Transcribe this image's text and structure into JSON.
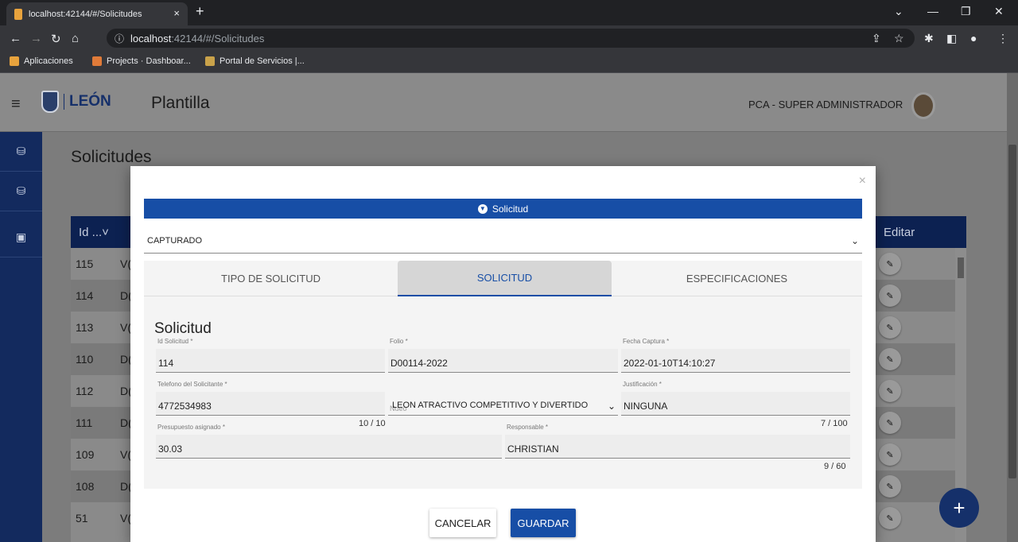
{
  "browser": {
    "tab_title": "localhost:42144/#/Solicitudes",
    "url_host": "localhost",
    "url_rest": ":42144/#/Solicitudes",
    "bookmarks": [
      "Aplicaciones",
      "Projects · Dashboar...",
      "Portal de Servicios |..."
    ]
  },
  "app": {
    "brand": "LEÓN",
    "title": "Plantilla",
    "user": "PCA - SUPER ADMINISTRADOR"
  },
  "page": {
    "title": "Solicitudes",
    "columns": {
      "id": "Id ...˅",
      "edit": "Editar"
    },
    "rows": [
      {
        "id": "115",
        "d": "V("
      },
      {
        "id": "114",
        "d": "D("
      },
      {
        "id": "113",
        "d": "V("
      },
      {
        "id": "110",
        "d": "D("
      },
      {
        "id": "112",
        "d": "D("
      },
      {
        "id": "111",
        "d": "D("
      },
      {
        "id": "109",
        "d": "V("
      },
      {
        "id": "108",
        "d": "D("
      },
      {
        "id": "51",
        "d": "V("
      }
    ],
    "fab_label": "+"
  },
  "modal": {
    "close": "×",
    "header": "Solicitud",
    "status": "CAPTURADO",
    "tabs": [
      "TIPO DE SOLICITUD",
      "SOLICITUD",
      "ESPECIFICACIONES"
    ],
    "panel_title": "Solicitud",
    "fields": {
      "id_label": "Id Solicitud *",
      "id_value": "114",
      "folio_label": "Folio *",
      "folio_value": "D00114-2022",
      "fecha_label": "Fecha Captura *",
      "fecha_value": "2022-01-10T14:10:27",
      "tel_label": "Telefono del Solicitante *",
      "tel_value": "4772534983",
      "tel_count": "10 / 10",
      "eje_label": "Nueo",
      "eje_value": "LEON ATRACTIVO COMPETITIVO Y DIVERTIDO",
      "just_label": "Justificación *",
      "just_value": "NINGUNA",
      "just_count": "7 / 100",
      "pres_label": "Presupuesto asignado *",
      "pres_value": "30.03",
      "resp_label": "Responsable *",
      "resp_value": "CHRISTIAN",
      "resp_count": "9 / 60"
    },
    "cancel": "CANCELAR",
    "save": "GUARDAR"
  }
}
